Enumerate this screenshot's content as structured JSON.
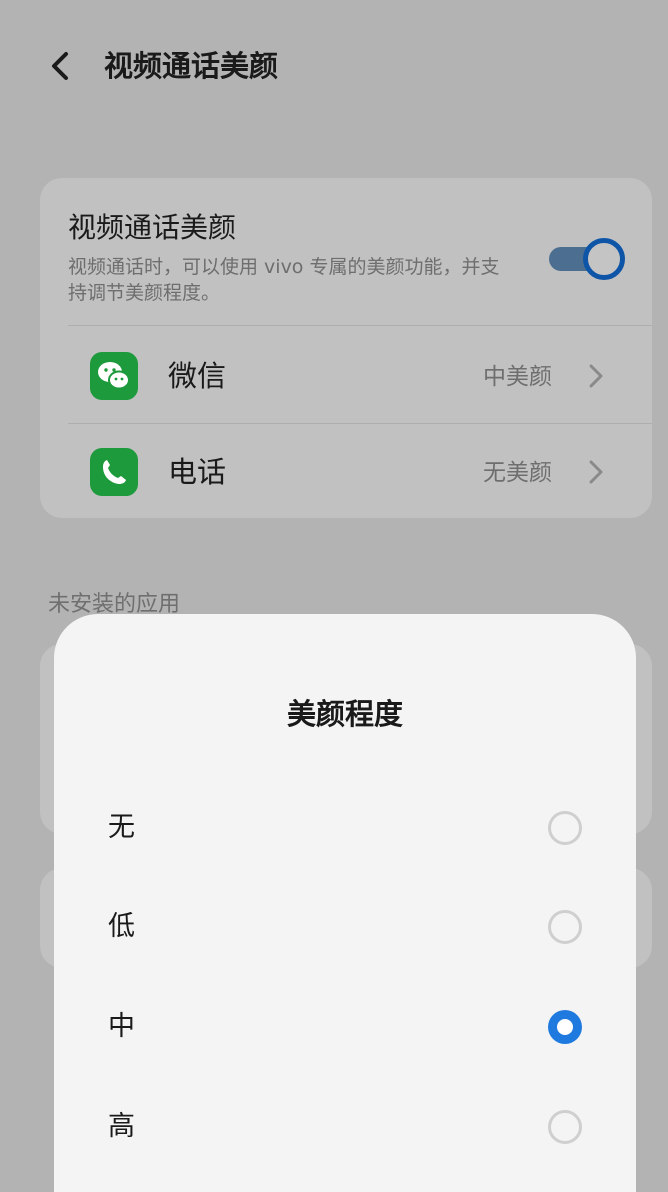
{
  "header": {
    "title": "视频通话美颜",
    "back_icon": "chevron-left-icon"
  },
  "beauty_card": {
    "title": "视频通话美颜",
    "description": "视频通话时，可以使用 vivo 专属的美颜功能，并支持调节美颜程度。",
    "toggle_on": true,
    "apps": [
      {
        "name": "微信",
        "value": "中美颜",
        "icon": "wechat-icon"
      },
      {
        "name": "电话",
        "value": "无美颜",
        "icon": "phone-icon"
      }
    ]
  },
  "uninstalled_section": {
    "label": "未安装的应用"
  },
  "sheet": {
    "title": "美颜程度",
    "options": [
      {
        "label": "无",
        "selected": false
      },
      {
        "label": "低",
        "selected": false
      },
      {
        "label": "中",
        "selected": true
      },
      {
        "label": "高",
        "selected": false
      }
    ]
  },
  "colors": {
    "accent": "#1f7ae0",
    "toggle_knob": "#0e55a8",
    "app_green": "#1d9a3c",
    "sheet_bg": "#f4f4f4"
  }
}
